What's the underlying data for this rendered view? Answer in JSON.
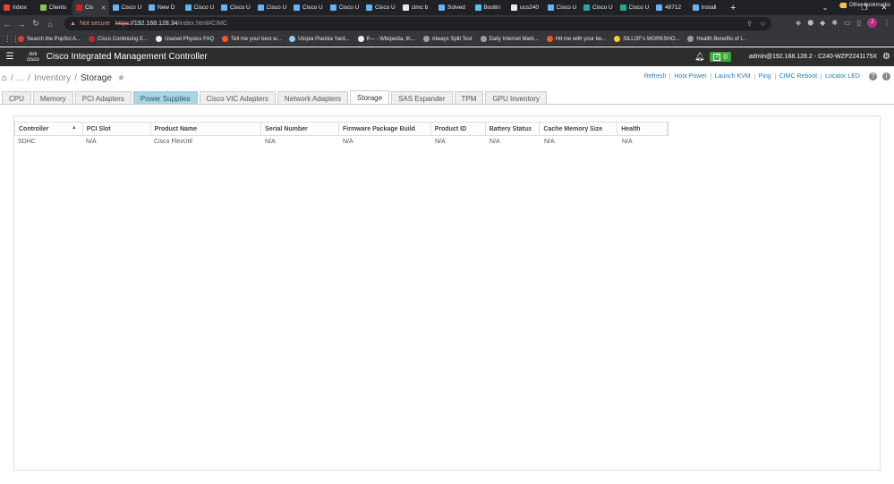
{
  "browser": {
    "tabs": [
      {
        "label": "Inbox",
        "icon": "gmail-icon",
        "color": "#ea4335"
      },
      {
        "label": "Clients",
        "icon": "sheets-icon",
        "color": "#8bc34a"
      },
      {
        "label": "Cis",
        "icon": "site-icon",
        "color": "#c62828",
        "active": true
      },
      {
        "label": "Cisco U",
        "icon": "page-icon",
        "color": "#64b5f6"
      },
      {
        "label": "New D",
        "icon": "page-icon",
        "color": "#64b5f6"
      },
      {
        "label": "Cisco U",
        "icon": "page-icon",
        "color": "#64b5f6"
      },
      {
        "label": "Cisco U",
        "icon": "page-icon",
        "color": "#64b5f6"
      },
      {
        "label": "Cisco U",
        "icon": "page-icon",
        "color": "#64b5f6"
      },
      {
        "label": "Cisco U",
        "icon": "page-icon",
        "color": "#64b5f6"
      },
      {
        "label": "Cisco U",
        "icon": "page-icon",
        "color": "#64b5f6"
      },
      {
        "label": "Cisco U",
        "icon": "page-icon",
        "color": "#64b5f6"
      },
      {
        "label": "cimc b",
        "icon": "google-icon",
        "color": "#e8eaed"
      },
      {
        "label": "Solved",
        "icon": "page-icon",
        "color": "#64b5f6"
      },
      {
        "label": "Bootin",
        "icon": "page-icon",
        "color": "#4fc3f7"
      },
      {
        "label": "ucs240",
        "icon": "google-icon",
        "color": "#e8eaed"
      },
      {
        "label": "Cisco U",
        "icon": "page-icon",
        "color": "#64b5f6"
      },
      {
        "label": "Cisco U",
        "icon": "page-icon",
        "color": "#26a69a"
      },
      {
        "label": "Cisco U",
        "icon": "page-icon",
        "color": "#26a69a"
      },
      {
        "label": "48712",
        "icon": "page-icon",
        "color": "#64b5f6"
      },
      {
        "label": "Install",
        "icon": "page-icon",
        "color": "#64b5f6"
      }
    ],
    "new_tab": "+",
    "window_controls": [
      "⌄",
      "–",
      "❐",
      "✕"
    ],
    "not_secure": "Not secure",
    "url_scheme": "https",
    "url_host": "://192.168.128.34",
    "url_path": "/index.html#CIMC",
    "bookmarks": [
      {
        "label": "Search the PopSci A...",
        "color": "#e53935"
      },
      {
        "label": "Cisco Continuing E...",
        "color": "#c62828"
      },
      {
        "label": "Usenet Physics FAQ",
        "color": "#eeeeee"
      },
      {
        "label": "Tell me your best w...",
        "color": "#ff5722"
      },
      {
        "label": "Utopia Planitia Yard...",
        "color": "#90caf9"
      },
      {
        "label": "If— - Wikipedia, th...",
        "color": "#eeeeee"
      },
      {
        "label": "Always Split Test",
        "color": "#9e9e9e"
      },
      {
        "label": "Daily Internet Mark...",
        "color": "#9e9e9e"
      },
      {
        "label": "Hit me with your be...",
        "color": "#ff5722"
      },
      {
        "label": "SILLOF's WORKSHO...",
        "color": "#ffca28"
      },
      {
        "label": "Health Benefits of t...",
        "color": "#9e9e9e"
      }
    ],
    "bookmarks_more": "»",
    "other_bookmarks": "Other bookmarks",
    "profile_initial": "J"
  },
  "header": {
    "logo_bars": "ılıılı",
    "logo_word": "cisco",
    "title": "Cisco Integrated Management Controller",
    "alert_count": "0",
    "user": "admin@192.168.128.2 - C240-WZP2241175X"
  },
  "breadcrumb": {
    "sep1": "/",
    "ellipsis": "...",
    "sep2": "/",
    "parent": "Inventory",
    "sep3": "/",
    "current": "Storage"
  },
  "actions": [
    "Refresh",
    "Host Power",
    "Launch KVM",
    "Ping",
    "CIMC Reboot",
    "Locator LED"
  ],
  "tabs": [
    {
      "label": "CPU"
    },
    {
      "label": "Memory"
    },
    {
      "label": "PCI Adapters"
    },
    {
      "label": "Power Supplies",
      "highlight": true
    },
    {
      "label": "Cisco VIC Adapters"
    },
    {
      "label": "Network Adapters"
    },
    {
      "label": "Storage",
      "active": true
    },
    {
      "label": "SAS Expander"
    },
    {
      "label": "TPM"
    },
    {
      "label": "GPU Inventory"
    }
  ],
  "table": {
    "columns": [
      "Controller",
      "PCI Slot",
      "Product Name",
      "Serial Number",
      "Firmware Package Build",
      "Product ID",
      "Battery Status",
      "Cache Memory Size",
      "Health"
    ],
    "sort_indicator": "▲",
    "rows": [
      [
        "SDHC",
        "N/A",
        "Cisco FlexUtil",
        "N/A",
        "N/A",
        "N/A",
        "N/A",
        "N/A",
        "N/A"
      ]
    ]
  }
}
